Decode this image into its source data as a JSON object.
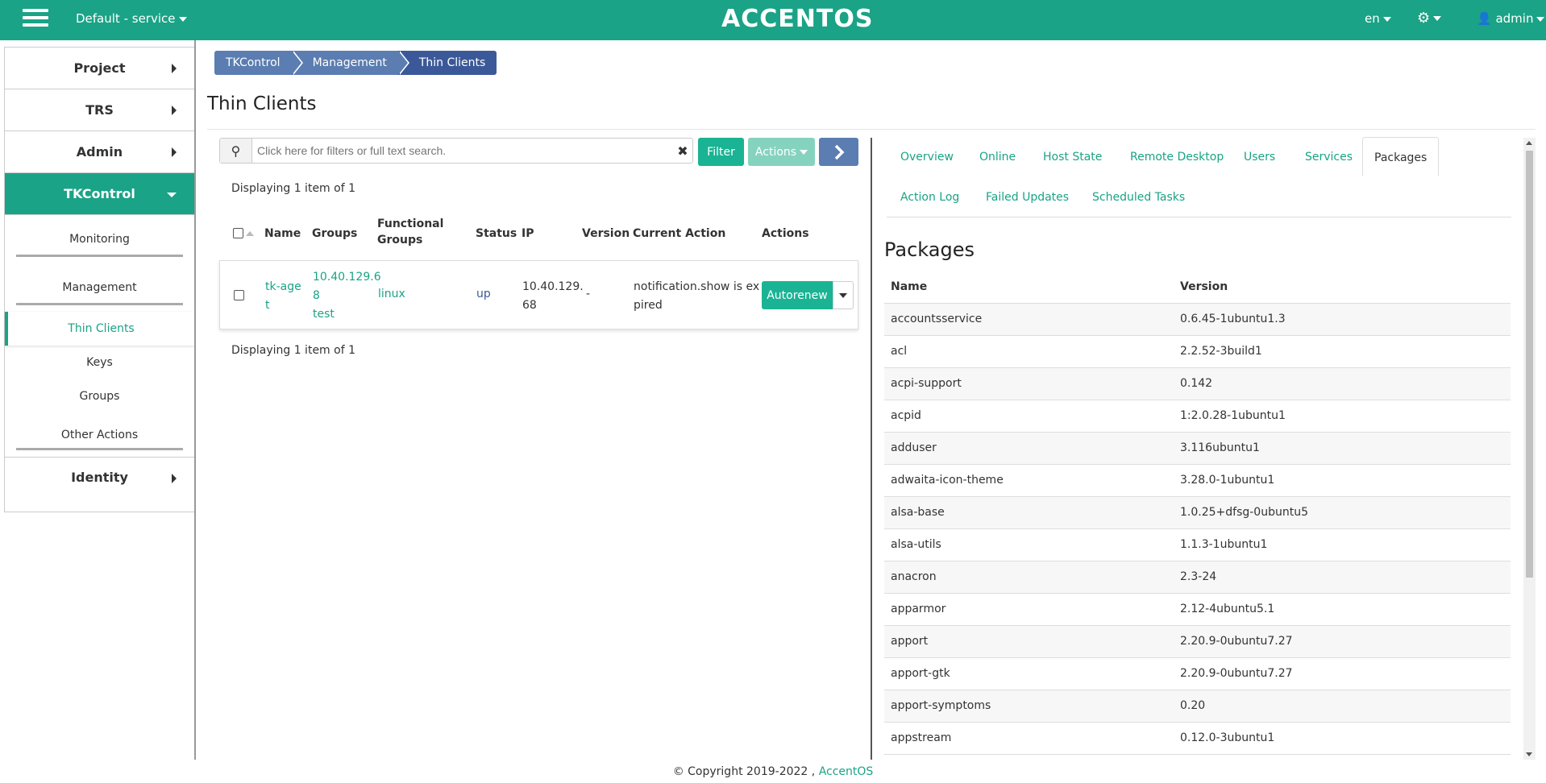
{
  "header": {
    "project": "Default - service",
    "logo": "ACCENTOS",
    "language": "en",
    "user": "admin",
    "brand_color": "#1aa386"
  },
  "sidebar": {
    "sections": [
      {
        "label": "Project"
      },
      {
        "label": "TRS"
      },
      {
        "label": "Admin"
      },
      {
        "label": "TKControl"
      }
    ],
    "tkcontrol": {
      "monitoring": "Monitoring",
      "management": "Management",
      "thin_clients": "Thin Clients",
      "keys": "Keys",
      "groups": "Groups",
      "other_actions": "Other Actions"
    },
    "identity": "Identity"
  },
  "breadcrumb": [
    "TKControl",
    "Management",
    "Thin Clients"
  ],
  "page_title": "Thin Clients",
  "search": {
    "placeholder": "Click here for filters or full text search."
  },
  "toolbar": {
    "filter": "Filter",
    "actions": "Actions"
  },
  "displaying": "Displaying 1 item of 1",
  "table": {
    "columns": {
      "name": "Name",
      "groups": "Groups",
      "functional_groups_1": "Functional",
      "functional_groups_2": "Groups",
      "status": "Status",
      "ip": "IP",
      "version": "Version",
      "current_action": "Current Action",
      "actions": "Actions"
    },
    "row": {
      "name_1": "tk-age",
      "name_2": "t",
      "groups_1": "10.40.129.6",
      "groups_2": "8",
      "groups_3": "test",
      "functional_groups": "linux",
      "status": "up",
      "ip_1": "10.40.129.",
      "ip_2": "68",
      "version": "-",
      "current_action_1": "notification.show is ex",
      "current_action_2": "pired",
      "action_button": "Autorenew"
    }
  },
  "tabs": [
    "Overview",
    "Online",
    "Host State",
    "Remote Desktop",
    "Users",
    "Services",
    "Packages",
    "Action Log",
    "Failed Updates",
    "Scheduled Tasks"
  ],
  "packages": {
    "title": "Packages",
    "col_name": "Name",
    "col_version": "Version",
    "rows": [
      {
        "name": "accountsservice",
        "version": "0.6.45-1ubuntu1.3"
      },
      {
        "name": "acl",
        "version": "2.2.52-3build1"
      },
      {
        "name": "acpi-support",
        "version": "0.142"
      },
      {
        "name": "acpid",
        "version": "1:2.0.28-1ubuntu1"
      },
      {
        "name": "adduser",
        "version": "3.116ubuntu1"
      },
      {
        "name": "adwaita-icon-theme",
        "version": "3.28.0-1ubuntu1"
      },
      {
        "name": "alsa-base",
        "version": "1.0.25+dfsg-0ubuntu5"
      },
      {
        "name": "alsa-utils",
        "version": "1.1.3-1ubuntu1"
      },
      {
        "name": "anacron",
        "version": "2.3-24"
      },
      {
        "name": "apparmor",
        "version": "2.12-4ubuntu5.1"
      },
      {
        "name": "apport",
        "version": "2.20.9-0ubuntu7.27"
      },
      {
        "name": "apport-gtk",
        "version": "2.20.9-0ubuntu7.27"
      },
      {
        "name": "apport-symptoms",
        "version": "0.20"
      },
      {
        "name": "appstream",
        "version": "0.12.0-3ubuntu1"
      }
    ]
  },
  "footer": {
    "copyright": "© Copyright 2019-2022 ,",
    "link": "AccentOS"
  }
}
